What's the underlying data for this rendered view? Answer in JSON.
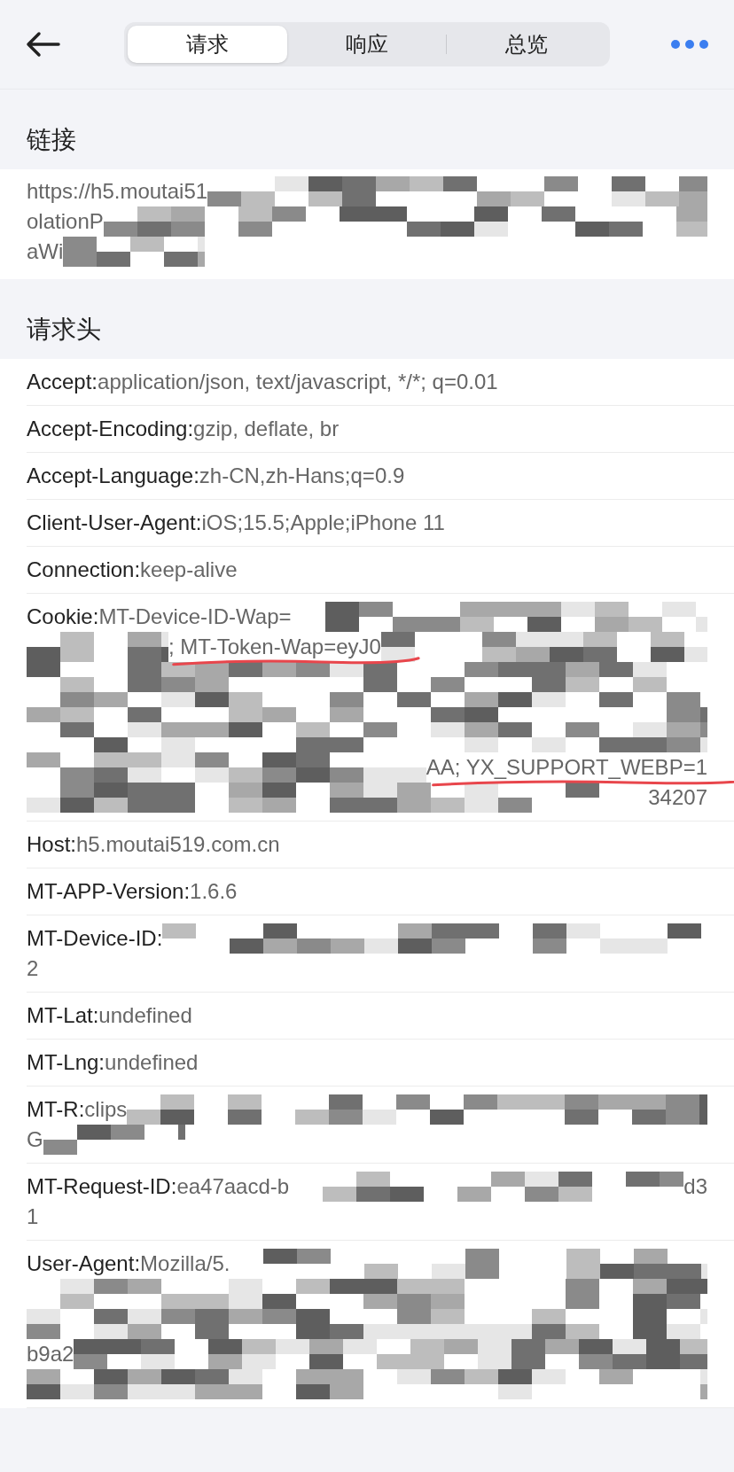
{
  "tabs": [
    {
      "label": "请求",
      "selected": true
    },
    {
      "label": "响应",
      "selected": false
    },
    {
      "label": "总览",
      "selected": false
    }
  ],
  "sections": [
    {
      "title": "链接",
      "kind": "url",
      "rows": [
        {
          "name": "",
          "lines": [
            [
              {
                "kind": "text",
                "text": "https://h5.moutai51"
              },
              {
                "kind": "mosaic"
              }
            ],
            [
              {
                "kind": "text",
                "text": "olationP"
              },
              {
                "kind": "mosaic"
              }
            ],
            [
              {
                "kind": "text",
                "text": "aWi"
              },
              {
                "kind": "mosaic_short"
              }
            ]
          ]
        }
      ]
    },
    {
      "title": "请求头",
      "kind": "headers",
      "rows": [
        {
          "name": "Accept:",
          "lines": [
            [
              {
                "kind": "text",
                "text": "application/json, text/javascript, */*; q=0.01"
              }
            ]
          ]
        },
        {
          "name": "Accept-Encoding:",
          "lines": [
            [
              {
                "kind": "text",
                "text": "gzip, deflate, br"
              }
            ]
          ]
        },
        {
          "name": "Accept-Language:",
          "lines": [
            [
              {
                "kind": "text",
                "text": "zh-CN,zh-Hans;q=0.9"
              }
            ]
          ]
        },
        {
          "name": "Client-User-Agent:",
          "lines": [
            [
              {
                "kind": "text",
                "text": "iOS;15.5;Apple;iPhone 11"
              }
            ]
          ]
        },
        {
          "name": "Connection:",
          "lines": [
            [
              {
                "kind": "text",
                "text": "keep-alive"
              }
            ]
          ]
        },
        {
          "name": "Cookie:",
          "lines": [
            [
              {
                "kind": "text",
                "text": "MT-Device-ID-Wap="
              },
              {
                "kind": "mosaic"
              }
            ],
            [
              {
                "kind": "mosaic_short"
              },
              {
                "kind": "text",
                "text": "; MT-Token-Wap=eyJ0",
                "underlined": true
              },
              {
                "kind": "mosaic"
              }
            ],
            [
              {
                "kind": "mosaic"
              }
            ],
            [
              {
                "kind": "mosaic"
              }
            ],
            [
              {
                "kind": "mosaic"
              }
            ],
            [
              {
                "kind": "mosaic"
              },
              {
                "kind": "text",
                "text": "AA; YX_SUPPORT_WEBP=1",
                "underlined": true
              }
            ],
            [
              {
                "kind": "mosaic"
              },
              {
                "kind": "text",
                "text": "34207"
              }
            ]
          ]
        },
        {
          "name": "Host:",
          "lines": [
            [
              {
                "kind": "text",
                "text": "h5.moutai519.com.cn"
              }
            ]
          ]
        },
        {
          "name": "MT-APP-Version:",
          "lines": [
            [
              {
                "kind": "text",
                "text": "1.6.6"
              }
            ]
          ]
        },
        {
          "name": "MT-Device-ID:",
          "lines": [
            [
              {
                "kind": "mosaic"
              }
            ],
            [
              {
                "kind": "text",
                "text": "2"
              }
            ]
          ]
        },
        {
          "name": "MT-Lat:",
          "lines": [
            [
              {
                "kind": "text",
                "text": "undefined"
              }
            ]
          ]
        },
        {
          "name": "MT-Lng:",
          "lines": [
            [
              {
                "kind": "text",
                "text": "undefined"
              }
            ]
          ]
        },
        {
          "name": "MT-R:",
          "lines": [
            [
              {
                "kind": "text",
                "text": "clips"
              },
              {
                "kind": "mosaic"
              }
            ],
            [
              {
                "kind": "text",
                "text": "G"
              },
              {
                "kind": "mosaic_short"
              }
            ]
          ]
        },
        {
          "name": "MT-Request-ID:",
          "lines": [
            [
              {
                "kind": "text",
                "text": "ea47aacd-b"
              },
              {
                "kind": "mosaic"
              },
              {
                "kind": "text",
                "text": "d3"
              }
            ],
            [
              {
                "kind": "text",
                "text": "1"
              }
            ]
          ]
        },
        {
          "name": "User-Agent:",
          "lines": [
            [
              {
                "kind": "text",
                "text": "Mozilla/5."
              },
              {
                "kind": "mosaic"
              }
            ],
            [
              {
                "kind": "mosaic"
              }
            ],
            [
              {
                "kind": "mosaic"
              }
            ],
            [
              {
                "kind": "text",
                "text": "b9a2"
              },
              {
                "kind": "mosaic"
              }
            ],
            [
              {
                "kind": "mosaic"
              }
            ]
          ]
        }
      ]
    }
  ]
}
